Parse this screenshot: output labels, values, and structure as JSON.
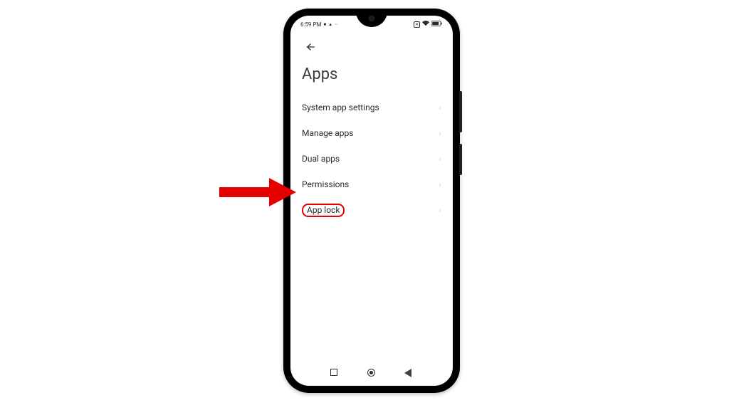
{
  "statusBar": {
    "time": "6:59 PM",
    "indicators": [
      "■",
      "▲",
      "··"
    ],
    "voIcon": "✕",
    "wifi": "◈",
    "battery": "▭"
  },
  "page": {
    "title": "Apps"
  },
  "menu": {
    "items": [
      {
        "label": "System app settings",
        "highlighted": false
      },
      {
        "label": "Manage apps",
        "highlighted": false
      },
      {
        "label": "Dual apps",
        "highlighted": false
      },
      {
        "label": "Permissions",
        "highlighted": false
      },
      {
        "label": "App lock",
        "highlighted": true
      }
    ]
  },
  "annotation": {
    "targetItemIndex": 4,
    "color": "#e40000"
  }
}
